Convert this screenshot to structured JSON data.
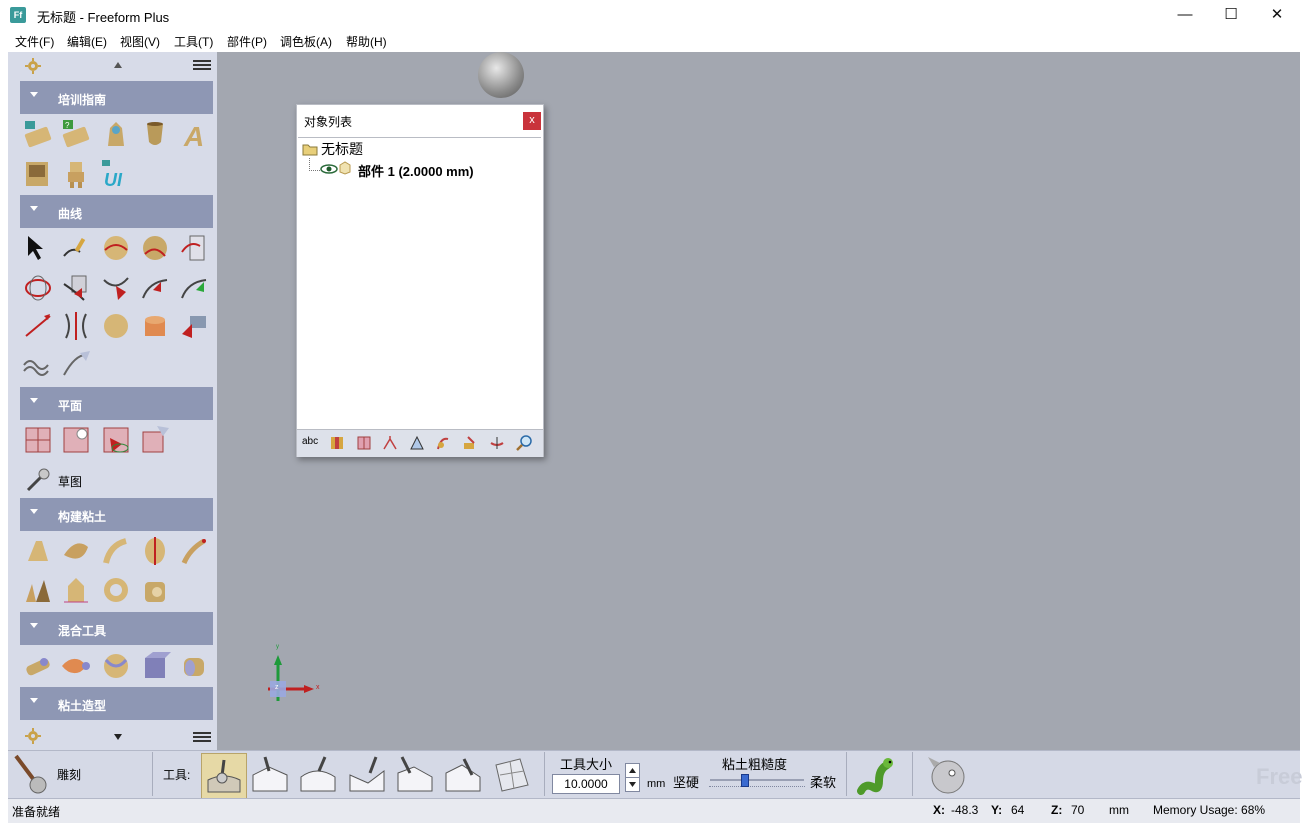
{
  "window": {
    "title": "无标题 - Freeform Plus",
    "app_icon": "Ff",
    "controls": {
      "minimize": "—",
      "maximize": "☐",
      "close": "✕"
    }
  },
  "menu": [
    "文件(F)",
    "编辑(E)",
    "视图(V)",
    "工具(T)",
    "部件(P)",
    "调色板(A)",
    "帮助(H)"
  ],
  "left_panel": {
    "sections": {
      "training": "培训指南",
      "curves": "曲线",
      "plane": "平面",
      "build_clay": "构建粘土",
      "blend_tools": "混合工具",
      "clay_modeling": "粘土造型"
    },
    "sketch_label": "草图"
  },
  "object_list": {
    "title": "对象列表",
    "close": "x",
    "root": "无标题",
    "part": "部件 1 (2.0000 mm)",
    "footer_abc": "abc"
  },
  "axis": {
    "x": "x",
    "y": "y",
    "z": "z"
  },
  "bottom": {
    "sculpt_label": "雕刻",
    "tool_label": "工具:",
    "tool_size_label": "工具大小",
    "tool_size_value": "10.0000",
    "tool_size_unit": "mm",
    "roughness_label": "粘土粗糙度",
    "hard_label": "坚硬",
    "soft_label": "柔软",
    "roughness_level": 0.35,
    "brand_watermark": "Free"
  },
  "status": {
    "ready": "准备就绪",
    "x_label": "X:",
    "x_value": "-48.3",
    "y_label": "Y:",
    "y_value": "64",
    "z_label": "Z:",
    "z_value": "70",
    "unit": "mm",
    "memory": "Memory Usage: 68%"
  },
  "colors": {
    "panel_bg": "#d7dbe8",
    "section_header": "#8e97b4",
    "viewport_bg": "#a3a7b0",
    "close_red": "#c9333b"
  }
}
